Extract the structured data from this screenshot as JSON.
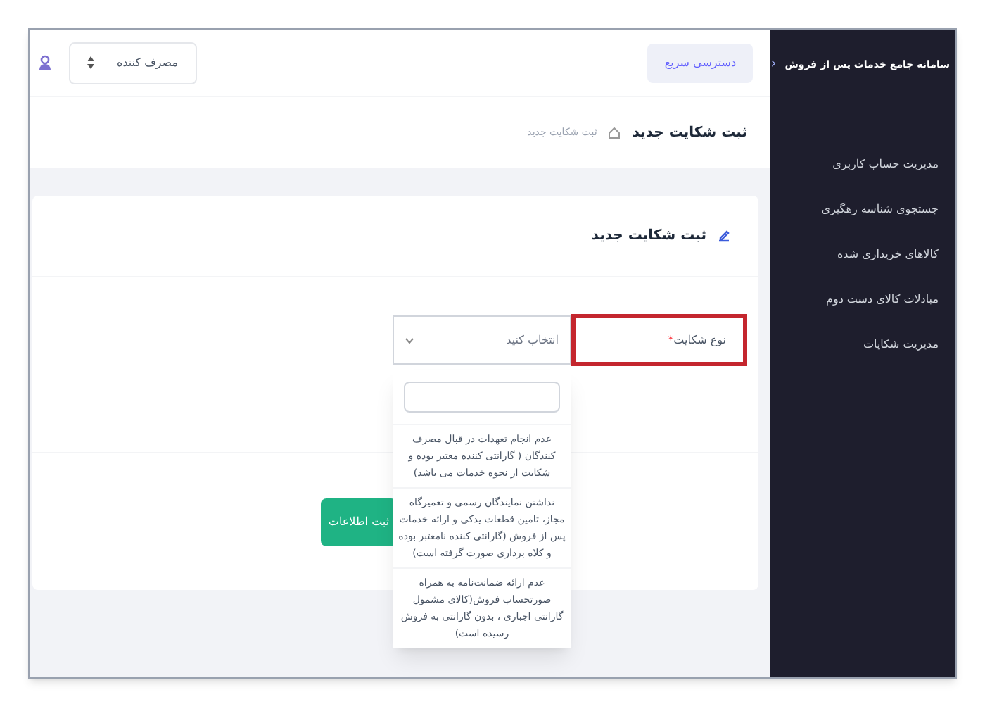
{
  "sidebar": {
    "title": "سامانه جامع خدمات پس از فروش",
    "collapse_icon": "‹",
    "items": [
      {
        "label": "مدیریت حساب کاربری",
        "selected": false
      },
      {
        "label": "جستجوی شناسه رهگیری",
        "selected": false
      },
      {
        "label": "کالاهای خریداری شده",
        "selected": false
      },
      {
        "label": "مبادلات کالای دست دوم",
        "selected": false
      },
      {
        "label": "مدیریت شکایات",
        "selected": false
      }
    ]
  },
  "topbar": {
    "quick_access": "دسترسی سریع",
    "role_select": "مصرف کننده"
  },
  "page_header": {
    "title": "ثبت شکایت جدید",
    "breadcrumb": "ثبت شکایت جدید"
  },
  "card": {
    "title": "ثبت شکایت جدید",
    "field": {
      "label": "نوع شکایت",
      "required_mark": "*",
      "highlighted": true,
      "placeholder": "انتخاب کنید"
    },
    "dropdown": {
      "options": [
        "عدم انجام تعهدات در قبال مصرف کنندگان ( گارانتی کننده معتبر بوده و شکایت از نحوه خدمات می باشد)",
        "نداشتن نمایندگان رسمی و تعمیرگاه مجاز، تامین قطعات یدکی و ارائه خدمات پس از فروش (گارانتی کننده نامعتبر بوده و کلاه برداری صورت گرفته است)",
        "عدم ارائه ضمانت‌نامه به همراه صورتحساب فروش(کالای مشمول گارانتی اجباری ، بدون گارانتی به فروش رسیده است)"
      ]
    },
    "submit": "ثبت اطلاعات"
  }
}
